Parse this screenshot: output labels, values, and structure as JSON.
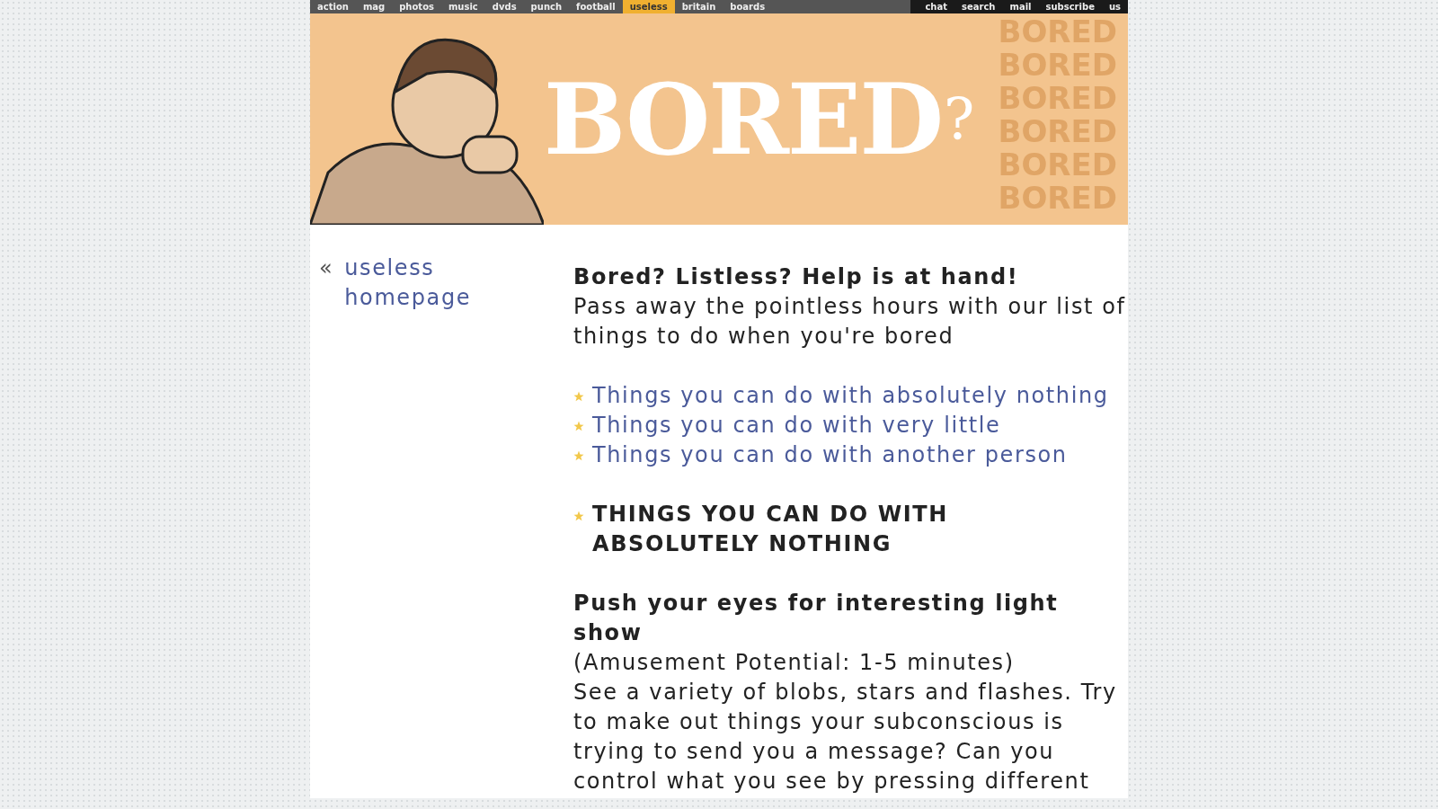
{
  "nav": {
    "left": [
      {
        "label": "action",
        "selected": false
      },
      {
        "label": "mag",
        "selected": false
      },
      {
        "label": "photos",
        "selected": false
      },
      {
        "label": "music",
        "selected": false
      },
      {
        "label": "dvds",
        "selected": false
      },
      {
        "label": "punch",
        "selected": false
      },
      {
        "label": "football",
        "selected": false
      },
      {
        "label": "useless",
        "selected": true
      },
      {
        "label": "britain",
        "selected": false
      },
      {
        "label": "boards",
        "selected": false
      }
    ],
    "right": [
      "chat",
      "search",
      "mail",
      "subscribe",
      "us"
    ]
  },
  "banner": {
    "title": "BORED",
    "mark": "?",
    "pattern": [
      "BORED",
      "BORED",
      "BORED",
      "BORED",
      "BORED",
      "BORED"
    ]
  },
  "sidebar": {
    "prefix": "«",
    "link": "useless homepage"
  },
  "intro": {
    "heading": "Bored? Listless? Help is at hand!",
    "text": "Pass away the pointless hours with our list of things to do when you're bored"
  },
  "links": [
    "Things you can do with absolutely nothing",
    "Things you can do with very little",
    "Things you can do with another person"
  ],
  "section": {
    "heading": "THINGS YOU CAN DO WITH ABSOLUTELY NOTHING"
  },
  "entries": [
    {
      "title": "Push your eyes for interesting light show",
      "potential": "(Amusement Potential: 1-5 minutes)",
      "text": "See a variety of blobs, stars and flashes. Try to make out things your subconscious is trying to send you a message? Can you control what you see by pressing different"
    }
  ]
}
